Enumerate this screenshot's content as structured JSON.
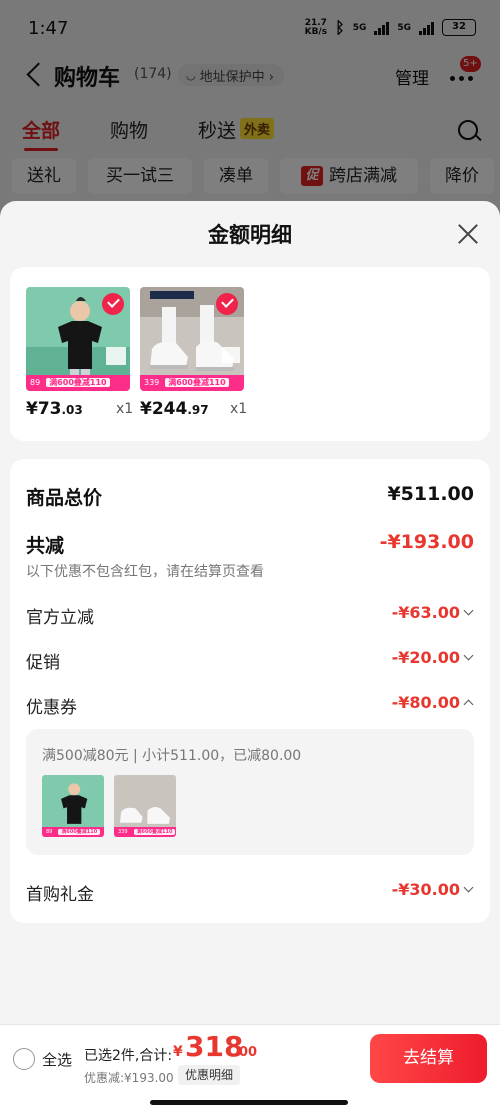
{
  "status_bar": {
    "time": "1:47",
    "net_speed_top": "21.7",
    "net_speed_bottom": "KB/s",
    "signal1": "5G",
    "signal2": "5G",
    "battery": "32"
  },
  "header": {
    "title": "购物车",
    "count": "(174)",
    "address_protect": "地址保护中 ›",
    "manage": "管理",
    "more_badge": "5+"
  },
  "tabs": [
    {
      "label": "全部"
    },
    {
      "label": "购物"
    },
    {
      "label": "秒送",
      "tag": "外卖"
    }
  ],
  "filter_chips": [
    {
      "label": "送礼"
    },
    {
      "label": "买一试三"
    },
    {
      "label": "凑单"
    },
    {
      "label": "跨店满减",
      "icon": "促"
    },
    {
      "label": "降价"
    }
  ],
  "sheet": {
    "title": "金额明细",
    "products": [
      {
        "price_int": "¥73",
        "price_dec": ".03",
        "qty": "x1",
        "strip_price": "89",
        "strip_promo": "满600叠减110",
        "image_desc": "man-in-black-tshirt"
      },
      {
        "price_int": "¥244",
        "price_dec": ".97",
        "qty": "x1",
        "strip_price": "339",
        "strip_promo": "满600叠减110",
        "image_desc": "white-sneakers"
      }
    ],
    "summary": {
      "total_label": "商品总价",
      "total_value": "¥511.00",
      "reduced_label": "共减",
      "reduced_value": "-¥193.00",
      "note": "以下优惠不包含红包，请在结算页查看",
      "items": [
        {
          "label": "官方立减",
          "value": "-¥63.00"
        },
        {
          "label": "促销",
          "value": "-¥20.00"
        },
        {
          "label": "优惠券",
          "value": "-¥80.00"
        },
        {
          "label": "首购礼金",
          "value": "-¥30.00"
        }
      ],
      "coupon_detail": "满500减80元 | 小计511.00，已减80.00"
    }
  },
  "bottom_bar": {
    "select_all": "全选",
    "selected": "已选2件,合计:",
    "currency": "¥",
    "total_int": "318",
    "total_dec": ".00",
    "discount": "优惠减:¥193.00",
    "detail_tag": "优惠明细",
    "checkout": "去结算"
  },
  "colors": {
    "accent": "#e8372e",
    "checkout": "#ee1c2d",
    "promo_strip": "#ff2d8a"
  }
}
